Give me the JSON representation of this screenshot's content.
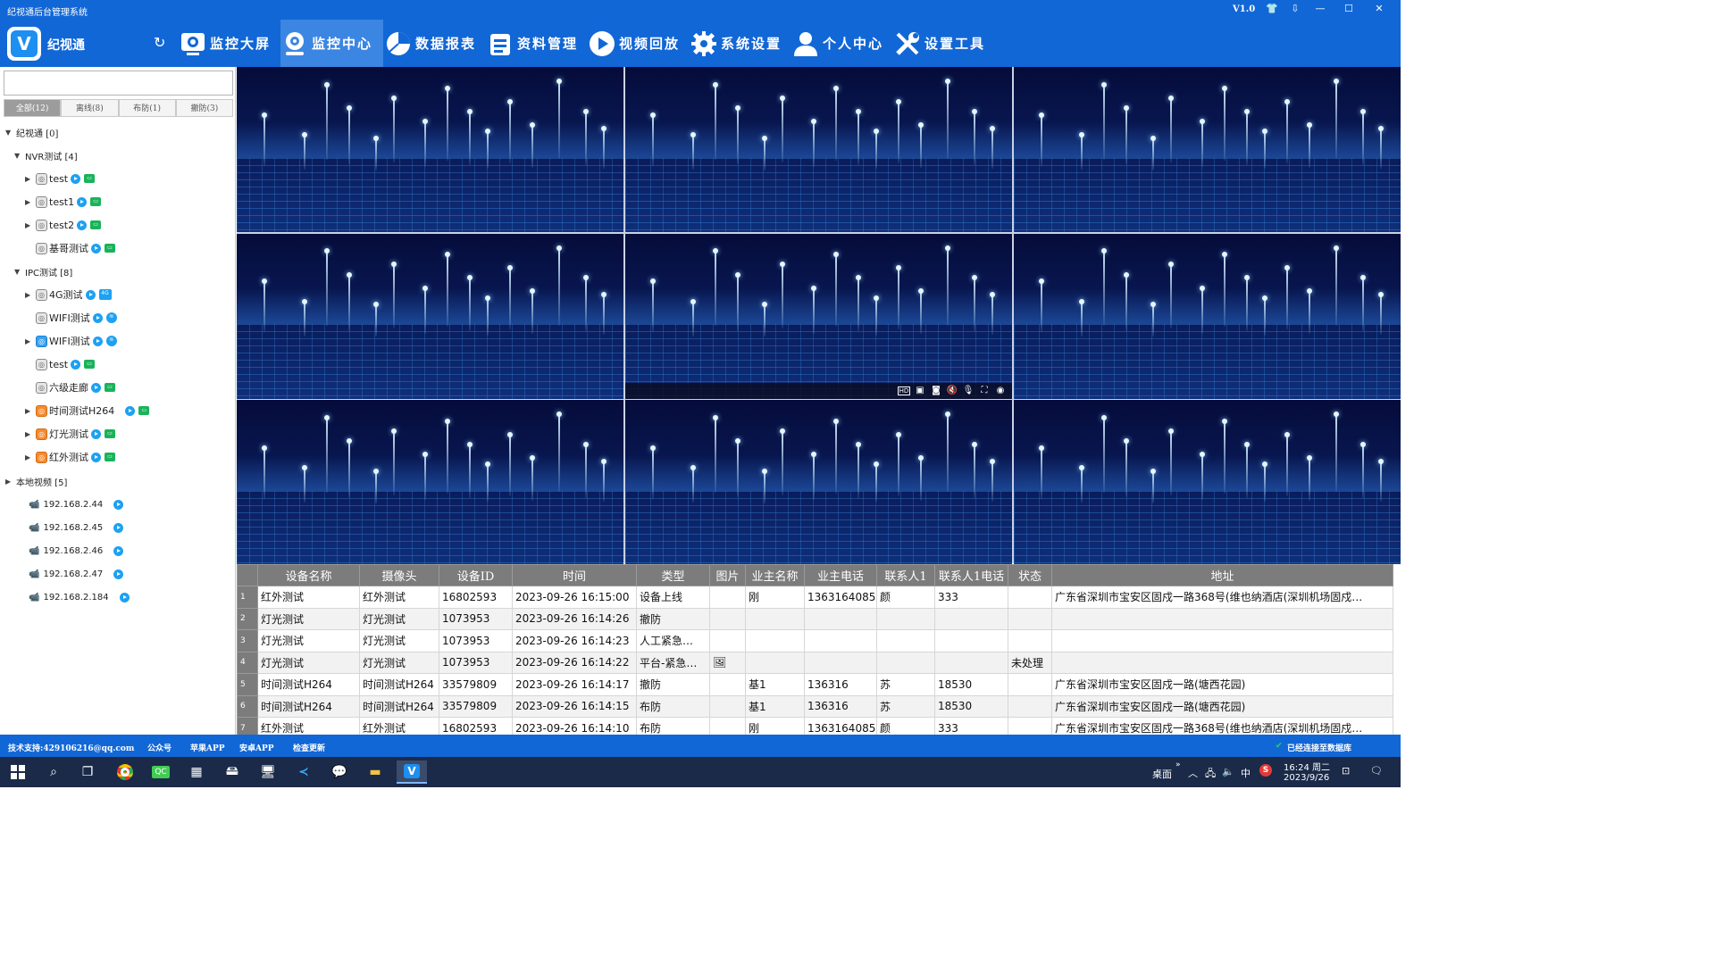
{
  "titlebar": {
    "title": "纪视通后台管理系统",
    "version": "V1.0"
  },
  "header": {
    "brand": "纪视通",
    "nav": [
      {
        "label": "监控大屏",
        "icon": "monitor-icon"
      },
      {
        "label": "监控中心",
        "icon": "camera-icon"
      },
      {
        "label": "数据报表",
        "icon": "pie-chart-icon"
      },
      {
        "label": "资料管理",
        "icon": "document-icon"
      },
      {
        "label": "视频回放",
        "icon": "play-icon"
      },
      {
        "label": "系统设置",
        "icon": "gear-icon"
      },
      {
        "label": "个人中心",
        "icon": "user-icon"
      },
      {
        "label": "设置工具",
        "icon": "tools-icon"
      }
    ]
  },
  "sidebar": {
    "filters": [
      "全部(12)",
      "离线(8)",
      "布防(1)",
      "撤防(3)"
    ],
    "tree": {
      "root": "纪视通 [0]",
      "nvr_group": "NVR测试 [4]",
      "nvr_items": [
        "test",
        "test1",
        "test2",
        "基哥测试"
      ],
      "ipc_group": "IPC测试 [8]",
      "ipc_items": [
        "4G测试",
        "WIFI测试",
        "WIFI测试",
        "test",
        "六级走廊",
        "时间测试H264",
        "灯光测试",
        "红外测试"
      ],
      "local_group": "本地视频 [5]",
      "local_items": [
        "192.168.2.44",
        "192.168.2.45",
        "192.168.2.46",
        "192.168.2.47",
        "192.168.2.184"
      ]
    }
  },
  "table": {
    "headers": [
      "设备名称",
      "摄像头",
      "设备ID",
      "时间",
      "类型",
      "图片",
      "业主名称",
      "业主电话",
      "联系人1",
      "联系人1电话",
      "状态",
      "地址"
    ],
    "rows": [
      [
        "1",
        "红外测试",
        "红外测试",
        "16802593",
        "2023-09-26 16:15:00",
        "设备上线",
        "",
        "刚",
        "1363164085",
        "颜",
        "333",
        "",
        "广东省深圳市宝安区固戍一路368号(维也纳酒店(深圳机场固戍…"
      ],
      [
        "2",
        "灯光测试",
        "灯光测试",
        "1073953",
        "2023-09-26 16:14:26",
        "撤防",
        "",
        "",
        "",
        "",
        "",
        "",
        ""
      ],
      [
        "3",
        "灯光测试",
        "灯光测试",
        "1073953",
        "2023-09-26 16:14:23",
        "人工紧急…",
        "",
        "",
        "",
        "",
        "",
        "",
        ""
      ],
      [
        "4",
        "灯光测试",
        "灯光测试",
        "1073953",
        "2023-09-26 16:14:22",
        "平台-紧急…",
        "🖼",
        "",
        "",
        "",
        "",
        "未处理",
        ""
      ],
      [
        "5",
        "时间测试H264",
        "时间测试H264",
        "33579809",
        "2023-09-26 16:14:17",
        "撤防",
        "",
        "基1",
        "136316",
        "苏",
        "18530",
        "",
        "广东省深圳市宝安区固戍一路(塘西花园)"
      ],
      [
        "6",
        "时间测试H264",
        "时间测试H264",
        "33579809",
        "2023-09-26 16:14:15",
        "布防",
        "",
        "基1",
        "136316",
        "苏",
        "18530",
        "",
        "广东省深圳市宝安区固戍一路(塘西花园)"
      ],
      [
        "7",
        "红外测试",
        "红外测试",
        "16802593",
        "2023-09-26 16:14:10",
        "布防",
        "",
        "刚",
        "1363164085",
        "颜",
        "333",
        "",
        "广东省深圳市宝安区固戍一路368号(维也纳酒店(深圳机场固戍…"
      ]
    ]
  },
  "statusbar": {
    "support": "技术支持:429106216@qq.com",
    "wechat": "公众号",
    "ios": "苹果APP",
    "android": "安卓APP",
    "update": "检查更新",
    "db": "已经连接至数据库"
  },
  "taskbar": {
    "desktop": "桌面",
    "ime": "中",
    "time": "16:24 周二",
    "date": "2023/9/26"
  }
}
